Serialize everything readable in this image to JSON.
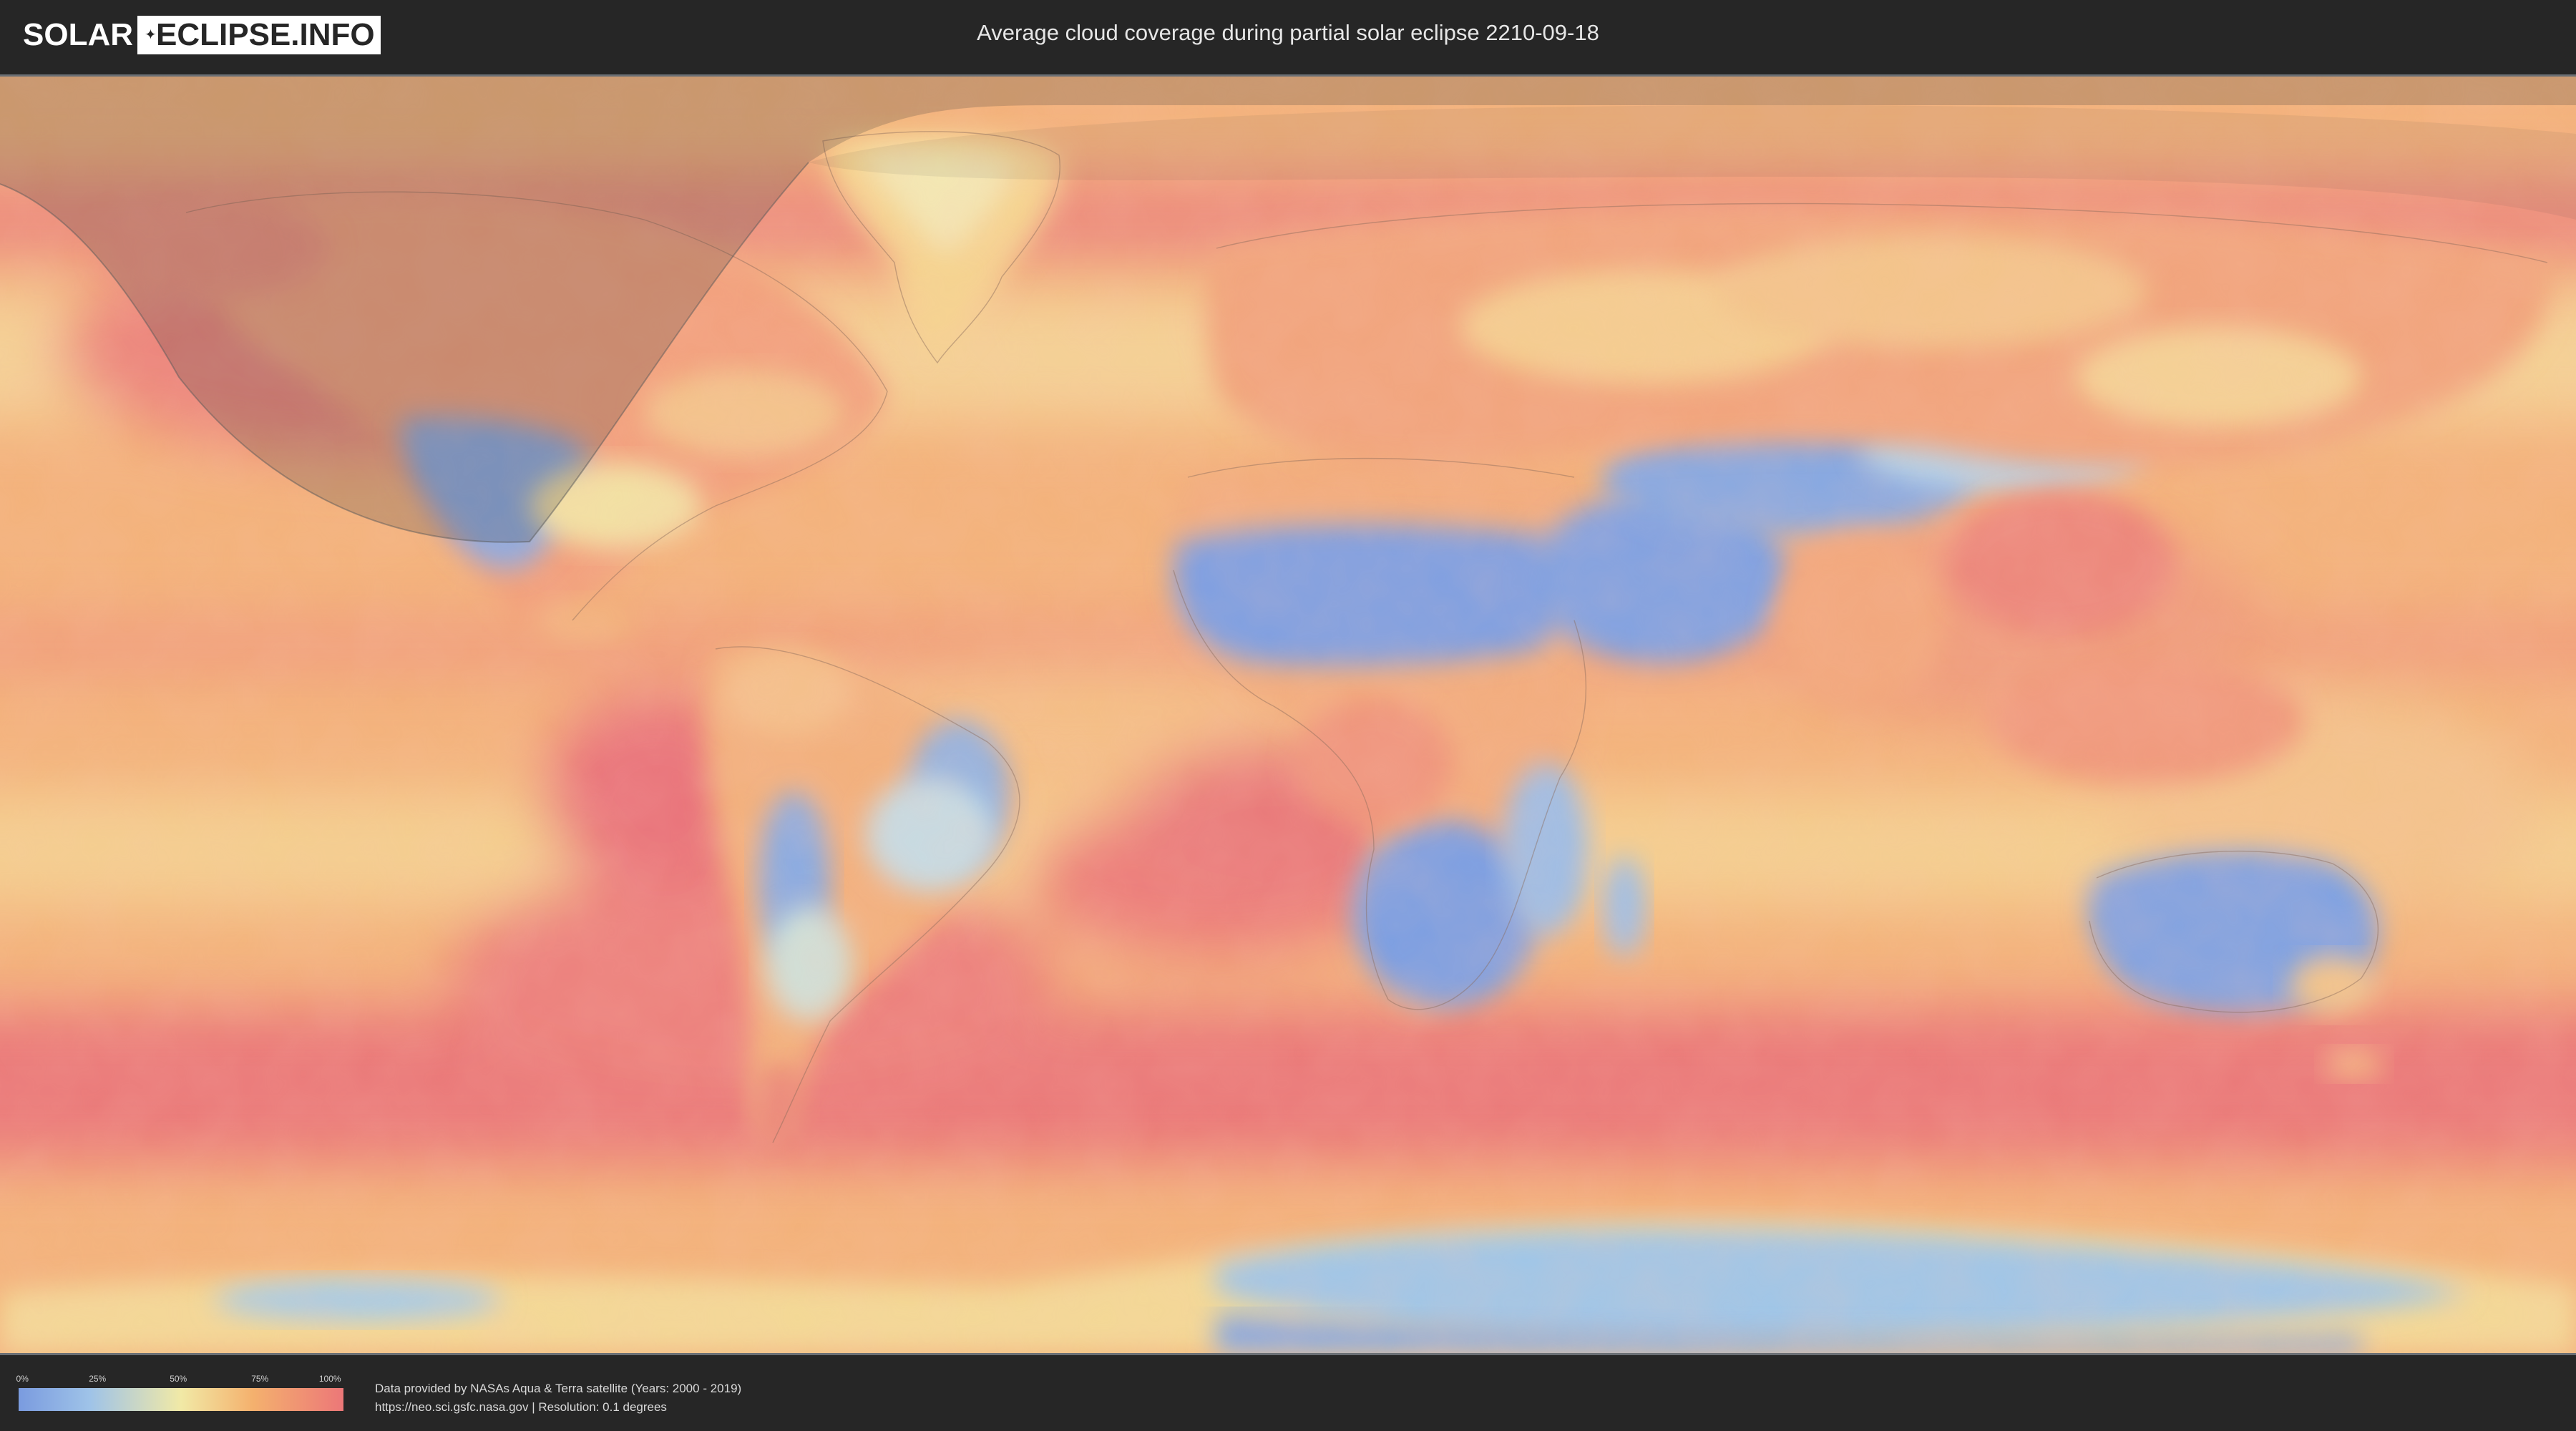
{
  "header": {
    "logo_part1": "SOLAR",
    "logo_part2": "ECLIPSE.INFO",
    "title": "Average cloud coverage during partial solar eclipse 2210-09-18"
  },
  "legend": {
    "ticks": [
      "0%",
      "25%",
      "50%",
      "75%",
      "100%"
    ],
    "colors": [
      "#7a9bdf",
      "#9fc3e8",
      "#f1e9a6",
      "#f4b16e",
      "#ec7778"
    ]
  },
  "credits": {
    "line1": "Data provided by NASAs Aqua & Terra satellite (Years: 2000 - 2019)",
    "line2": "https://neo.sci.gsfc.nasa.gov | Resolution: 0.1 degrees"
  },
  "map": {
    "icons": [
      "world-map",
      "eclipse-shadow-overlay"
    ],
    "colors": {
      "clear": "#7da3e3",
      "low": "#a9cde6",
      "mid": "#f2e3a3",
      "high": "#f4b070",
      "overcast": "#eb7f78",
      "shadow": "#3a3a3a"
    }
  }
}
